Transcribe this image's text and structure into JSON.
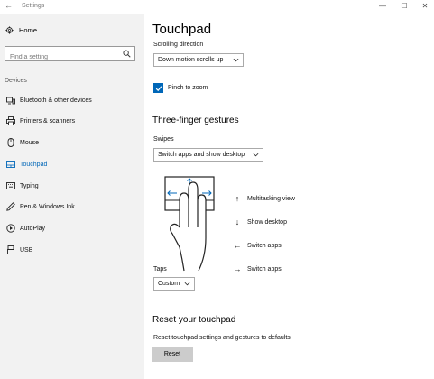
{
  "window": {
    "title": "Settings",
    "back_glyph": "←",
    "min_glyph": "—",
    "max_glyph": "☐",
    "close_glyph": "✕"
  },
  "sidebar": {
    "home_label": "Home",
    "search_placeholder": "Find a setting",
    "section_label": "Devices",
    "items": [
      {
        "label": "Bluetooth & other devices",
        "icon": "bluetooth-devices-icon"
      },
      {
        "label": "Printers & scanners",
        "icon": "printer-icon"
      },
      {
        "label": "Mouse",
        "icon": "mouse-icon"
      },
      {
        "label": "Touchpad",
        "icon": "touchpad-icon",
        "active": true
      },
      {
        "label": "Typing",
        "icon": "keyboard-icon"
      },
      {
        "label": "Pen & Windows Ink",
        "icon": "pen-icon"
      },
      {
        "label": "AutoPlay",
        "icon": "autoplay-icon"
      },
      {
        "label": "USB",
        "icon": "usb-icon"
      }
    ],
    "accent_color": "#0067b8"
  },
  "main": {
    "title": "Touchpad",
    "scrolling_direction_label": "Scrolling direction",
    "scrolling_direction_value": "Down motion scrolls up",
    "pinch_label": "Pinch to zoom",
    "pinch_checked": true,
    "three_finger_heading": "Three-finger gestures",
    "swipes_label": "Swipes",
    "swipes_value": "Switch apps and show desktop",
    "gestures": [
      {
        "arrow": "↑",
        "label": "Multitasking view"
      },
      {
        "arrow": "↓",
        "label": "Show desktop"
      },
      {
        "arrow": "←",
        "label": "Switch apps"
      },
      {
        "arrow": "→",
        "label": "Switch apps"
      }
    ],
    "taps_label": "Taps",
    "taps_value": "Custom",
    "reset_heading": "Reset your touchpad",
    "reset_description": "Reset touchpad settings and gestures to defaults",
    "reset_button": "Reset"
  }
}
